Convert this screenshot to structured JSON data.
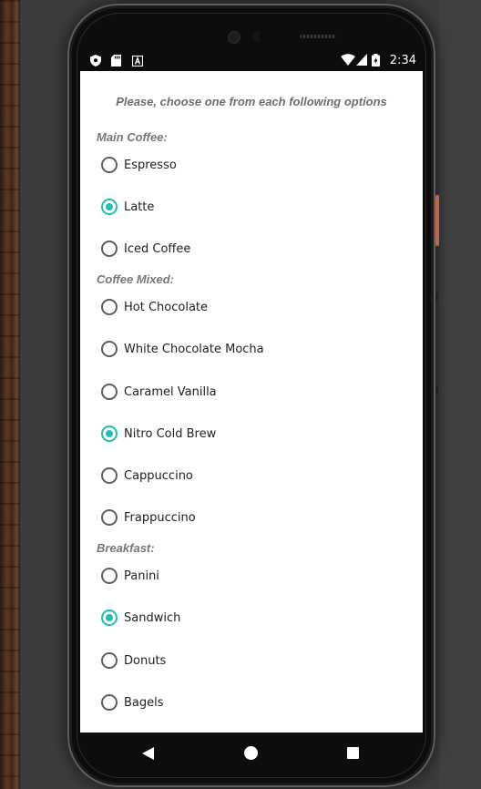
{
  "status_bar": {
    "time": "2:34",
    "left_icons": [
      "shield-icon",
      "sd-card-icon",
      "a-letter-icon"
    ],
    "right_icons": [
      "wifi-icon",
      "signal-icon",
      "battery-icon"
    ]
  },
  "colors": {
    "accent": "#21bfb1",
    "background": "#3a3b3d"
  },
  "form": {
    "instruction": "Please, choose one from each following options",
    "sections": [
      {
        "label": "Main Coffee:",
        "options": [
          {
            "label": "Espresso",
            "checked": false
          },
          {
            "label": "Latte",
            "checked": true
          },
          {
            "label": "Iced Coffee",
            "checked": false
          }
        ]
      },
      {
        "label": "Coffee Mixed:",
        "options": [
          {
            "label": "Hot Chocolate",
            "checked": false
          },
          {
            "label": "White Chocolate Mocha",
            "checked": false
          },
          {
            "label": "Caramel Vanilla",
            "checked": false
          },
          {
            "label": "Nitro Cold Brew",
            "checked": true
          },
          {
            "label": "Cappuccino",
            "checked": false
          },
          {
            "label": "Frappuccino",
            "checked": false
          }
        ]
      },
      {
        "label": "Breakfast:",
        "options": [
          {
            "label": "Panini",
            "checked": false
          },
          {
            "label": "Sandwich",
            "checked": true
          },
          {
            "label": "Donuts",
            "checked": false
          },
          {
            "label": "Bagels",
            "checked": false
          }
        ]
      }
    ]
  },
  "nav_bar": {
    "icons": [
      "back-icon",
      "home-icon",
      "recents-icon"
    ]
  }
}
